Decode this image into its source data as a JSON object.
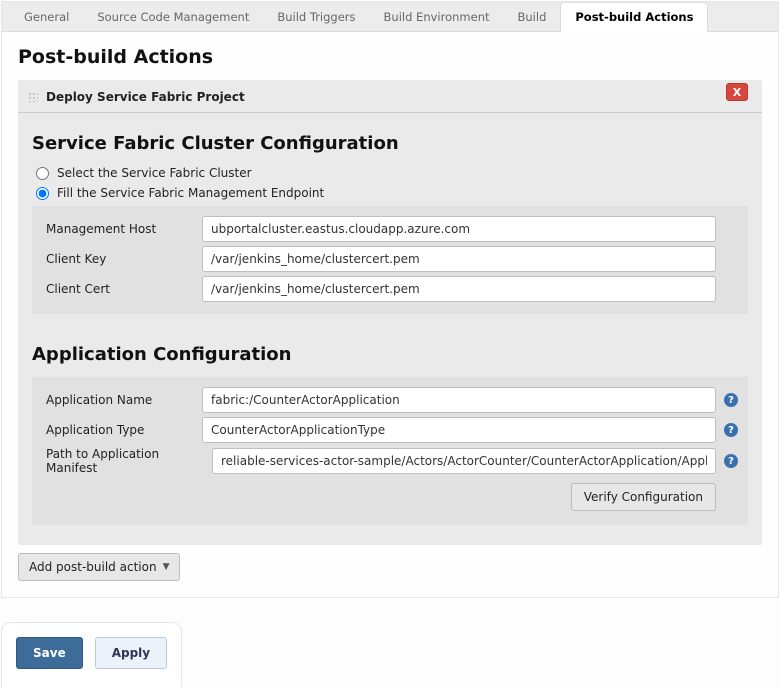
{
  "tabs": [
    "General",
    "Source Code Management",
    "Build Triggers",
    "Build Environment",
    "Build",
    "Post-build Actions"
  ],
  "active_tab": "Post-build Actions",
  "page_title": "Post-build Actions",
  "section": {
    "title": "Deploy Service Fabric Project",
    "close_label": "X"
  },
  "cluster_config": {
    "heading": "Service Fabric Cluster Configuration",
    "radio_options": [
      "Select the Service Fabric Cluster",
      "Fill the Service Fabric Management Endpoint"
    ],
    "selected_radio": 1,
    "fields": [
      {
        "label": "Management Host",
        "value": "ubportalcluster.eastus.cloudapp.azure.com"
      },
      {
        "label": "Client Key",
        "value": "/var/jenkins_home/clustercert.pem"
      },
      {
        "label": "Client Cert",
        "value": "/var/jenkins_home/clustercert.pem"
      }
    ]
  },
  "app_config": {
    "heading": "Application Configuration",
    "fields": [
      {
        "label": "Application Name",
        "value": "fabric:/CounterActorApplication"
      },
      {
        "label": "Application Type",
        "value": "CounterActorApplicationType"
      },
      {
        "label": "Path to Application Manifest",
        "value": "reliable-services-actor-sample/Actors/ActorCounter/CounterActorApplication/ApplicationManifest"
      }
    ],
    "verify_label": "Verify Configuration"
  },
  "add_action_label": "Add post-build action",
  "footer": {
    "save": "Save",
    "apply": "Apply"
  }
}
